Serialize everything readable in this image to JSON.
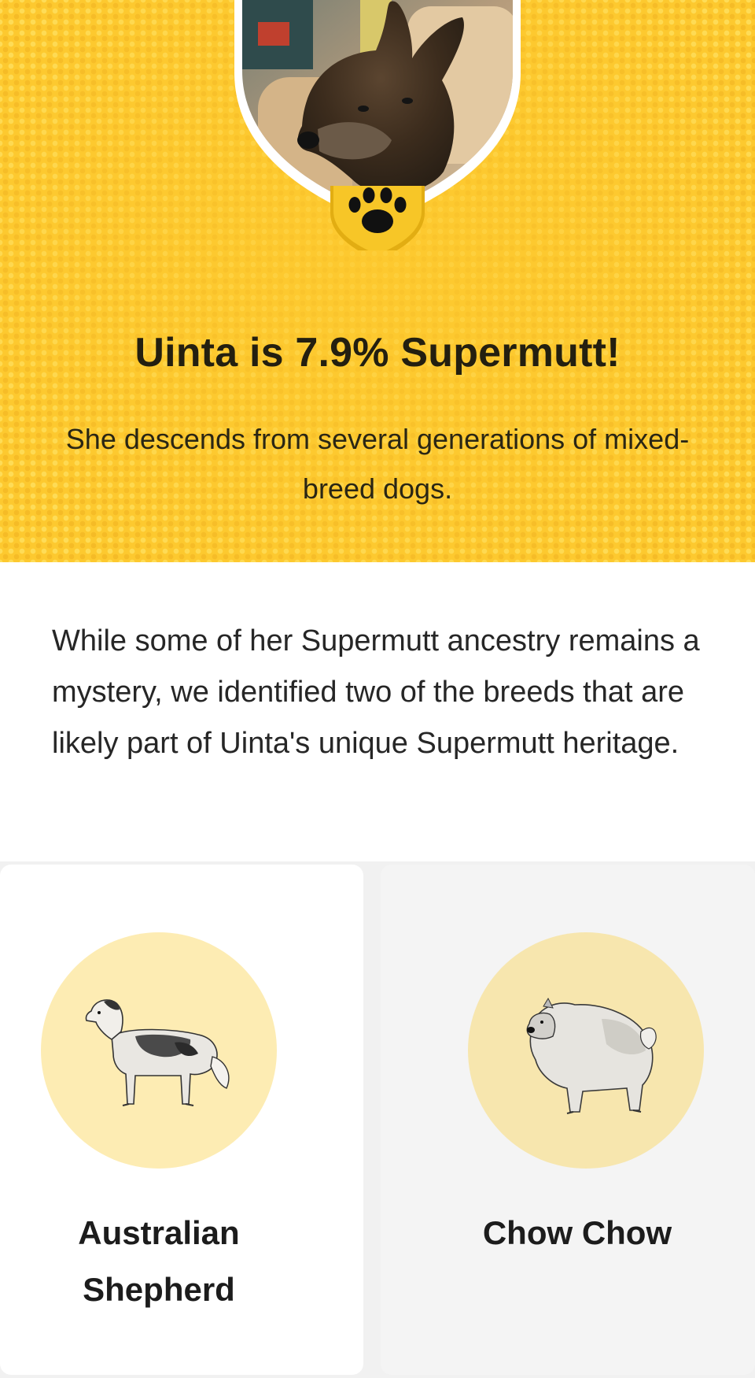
{
  "hero": {
    "title": "Uinta is 7.9% Supermutt!",
    "subtitle": "She descends from several generations of mixed-breed dogs.",
    "badge_icon": "paw-icon",
    "photo": "dog-photo",
    "background_color": "#fdc92f"
  },
  "intro": {
    "text": "While some of her Supermutt ancestry remains a mystery, we identified two of the breeds that are likely part of Uinta's unique Supermutt heritage."
  },
  "breeds": [
    {
      "name": "Australian Shepherd",
      "illustration": "australian-shepherd-illustration"
    },
    {
      "name": "Chow Chow",
      "illustration": "chow-chow-illustration"
    }
  ],
  "colors": {
    "accent": "#fdc92f",
    "badge_gold": "#f5c22b",
    "circle_light": "#fdecb3",
    "text_dark": "#231f10"
  }
}
